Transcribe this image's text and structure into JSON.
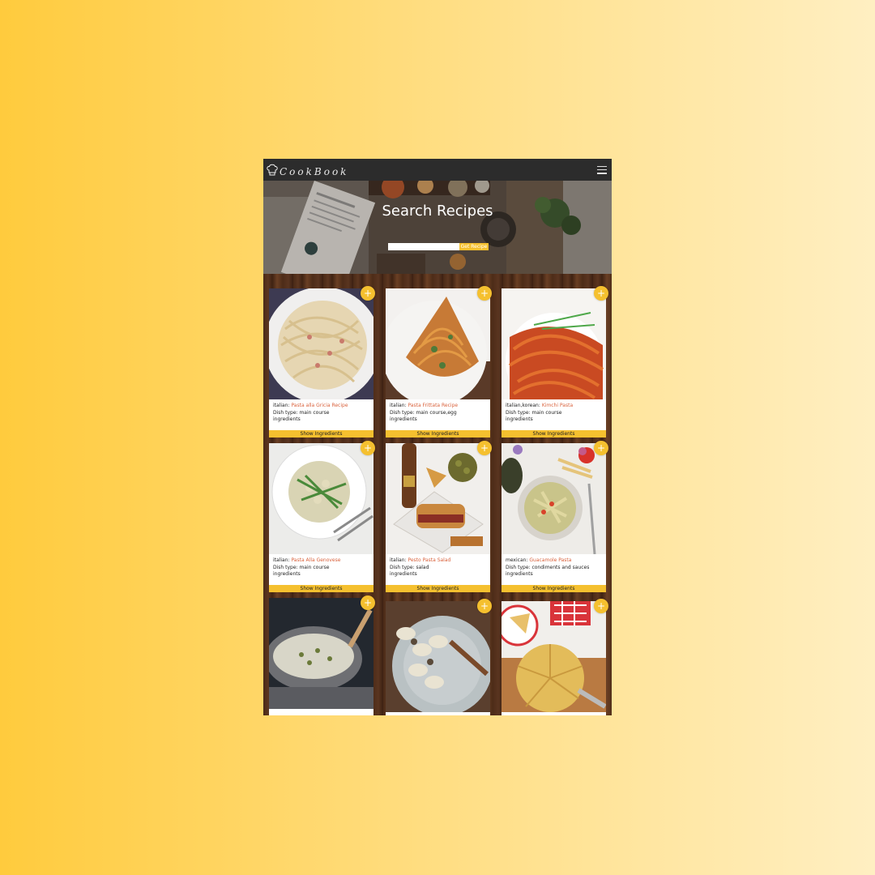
{
  "app": {
    "brand": "CookBook",
    "brand_icon": "chef-hat-icon",
    "menu_icon": "hamburger-menu-icon"
  },
  "hero": {
    "title": "Search Recipes",
    "search_value": "",
    "search_button": "Get Recipe"
  },
  "cards": [
    {
      "cuisine": "italian:",
      "title": "Pasta alla Gricia Recipe",
      "dish_type": "Dish type: main course",
      "ingredients_label": "ingredients",
      "show_button": "Show Ingredients",
      "add_button": "+"
    },
    {
      "cuisine": "italian:",
      "title": "Pasta Frittata Recipe",
      "dish_type": "Dish type: main course,egg",
      "ingredients_label": "ingredients",
      "show_button": "Show Ingredients",
      "add_button": "+"
    },
    {
      "cuisine": "italian,korean:",
      "title": "Kimchi Pasta",
      "dish_type": "Dish type: main course",
      "ingredients_label": "ingredients",
      "show_button": "Show Ingredients",
      "add_button": "+"
    },
    {
      "cuisine": "italian:",
      "title": "Pasta Alla Genovese",
      "dish_type": "Dish type: main course",
      "ingredients_label": "ingredients",
      "show_button": "Show Ingredients",
      "add_button": "+"
    },
    {
      "cuisine": "italian:",
      "title": "Pesto Pasta Salad",
      "dish_type": "Dish type: salad",
      "ingredients_label": "ingredients",
      "show_button": "Show Ingredients",
      "add_button": "+"
    },
    {
      "cuisine": "mexican:",
      "title": "Guacamole Pasta",
      "dish_type": "Dish type: condiments and sauces",
      "ingredients_label": "ingredients",
      "show_button": "Show Ingredients",
      "add_button": "+"
    },
    {
      "add_button": "+"
    },
    {
      "add_button": "+"
    },
    {
      "add_button": "+"
    }
  ],
  "colors": {
    "accent": "#f5c02f",
    "navbar": "#2c2c2c",
    "title_link": "#d9613b"
  }
}
